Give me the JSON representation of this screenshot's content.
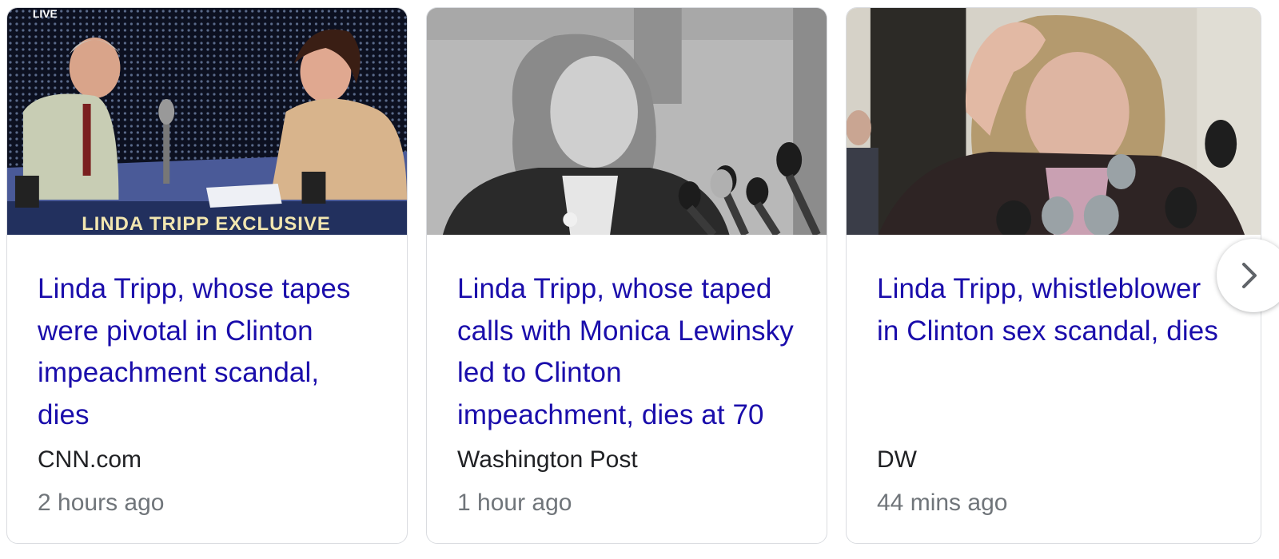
{
  "cards": [
    {
      "headline": "Linda Tripp, whose tapes were pivotal in Clinton impeachment scandal, dies",
      "source": "CNN.com",
      "time": "2 hours ago",
      "image_caption": "LINDA TRIPP EXCLUSIVE",
      "image_badge": "LIVE"
    },
    {
      "headline": "Linda Tripp, whose taped calls with Monica Lewinsky led to Clinton impeachment, dies at 70",
      "source": "Washington Post",
      "time": "1 hour ago"
    },
    {
      "headline": "Linda Tripp, whistleblower in Clinton sex scandal, dies",
      "source": "DW",
      "time": "44 mins ago"
    }
  ],
  "next_button": {
    "icon": "chevron-right-icon"
  },
  "colors": {
    "headline": "#1a0dab",
    "source": "#202124",
    "time": "#70757a",
    "border": "#dadce0"
  }
}
